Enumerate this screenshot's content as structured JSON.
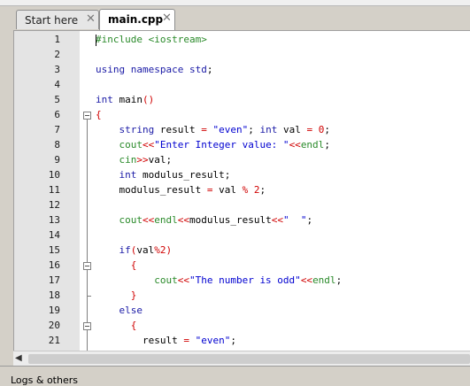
{
  "tabs": [
    {
      "label": "Start here",
      "close": "✕",
      "active": false
    },
    {
      "label": "main.cpp",
      "close": "✕",
      "active": true
    }
  ],
  "line_numbers": [
    "1",
    "2",
    "3",
    "4",
    "5",
    "6",
    "7",
    "8",
    "9",
    "10",
    "11",
    "12",
    "13",
    "14",
    "15",
    "16",
    "17",
    "18",
    "19",
    "20",
    "21"
  ],
  "code_lines": [
    [
      {
        "t": "#include <iostream>",
        "c": "pp"
      }
    ],
    [],
    [
      {
        "t": "using namespace ",
        "c": "kw"
      },
      {
        "t": "std",
        "c": "kw"
      },
      {
        "t": ";",
        "c": "plain"
      }
    ],
    [],
    [
      {
        "t": "int ",
        "c": "kw"
      },
      {
        "t": "main",
        "c": "plain"
      },
      {
        "t": "()",
        "c": "op"
      }
    ],
    [
      {
        "t": "{",
        "c": "op"
      }
    ],
    [
      {
        "t": "    string ",
        "c": "kw"
      },
      {
        "t": "result ",
        "c": "plain"
      },
      {
        "t": "= ",
        "c": "op"
      },
      {
        "t": "\"even\"",
        "c": "str"
      },
      {
        "t": "; ",
        "c": "plain"
      },
      {
        "t": "int ",
        "c": "kw"
      },
      {
        "t": "val ",
        "c": "plain"
      },
      {
        "t": "= ",
        "c": "op"
      },
      {
        "t": "0",
        "c": "num"
      },
      {
        "t": ";",
        "c": "plain"
      }
    ],
    [
      {
        "t": "    cout",
        "c": "io"
      },
      {
        "t": "<<",
        "c": "op"
      },
      {
        "t": "\"Enter Integer value: \"",
        "c": "str"
      },
      {
        "t": "<<",
        "c": "op"
      },
      {
        "t": "endl",
        "c": "io"
      },
      {
        "t": ";",
        "c": "plain"
      }
    ],
    [
      {
        "t": "    cin",
        "c": "io"
      },
      {
        "t": ">>",
        "c": "op"
      },
      {
        "t": "val",
        "c": "plain"
      },
      {
        "t": ";",
        "c": "plain"
      }
    ],
    [
      {
        "t": "    int ",
        "c": "kw"
      },
      {
        "t": "modulus_result",
        "c": "plain"
      },
      {
        "t": ";",
        "c": "plain"
      }
    ],
    [
      {
        "t": "    modulus_result ",
        "c": "plain"
      },
      {
        "t": "= ",
        "c": "op"
      },
      {
        "t": "val ",
        "c": "plain"
      },
      {
        "t": "% ",
        "c": "op"
      },
      {
        "t": "2",
        "c": "num"
      },
      {
        "t": ";",
        "c": "plain"
      }
    ],
    [],
    [
      {
        "t": "    cout",
        "c": "io"
      },
      {
        "t": "<<",
        "c": "op"
      },
      {
        "t": "endl",
        "c": "io"
      },
      {
        "t": "<<",
        "c": "op"
      },
      {
        "t": "modulus_result",
        "c": "plain"
      },
      {
        "t": "<<",
        "c": "op"
      },
      {
        "t": "\"  \"",
        "c": "str"
      },
      {
        "t": ";",
        "c": "plain"
      }
    ],
    [],
    [
      {
        "t": "    if",
        "c": "kw"
      },
      {
        "t": "(",
        "c": "op"
      },
      {
        "t": "val",
        "c": "plain"
      },
      {
        "t": "%",
        "c": "op"
      },
      {
        "t": "2",
        "c": "num"
      },
      {
        "t": ")",
        "c": "op"
      }
    ],
    [
      {
        "t": "      {",
        "c": "op"
      }
    ],
    [
      {
        "t": "          cout",
        "c": "io"
      },
      {
        "t": "<<",
        "c": "op"
      },
      {
        "t": "\"The number is odd\"",
        "c": "str"
      },
      {
        "t": "<<",
        "c": "op"
      },
      {
        "t": "endl",
        "c": "io"
      },
      {
        "t": ";",
        "c": "plain"
      }
    ],
    [
      {
        "t": "      }",
        "c": "op"
      }
    ],
    [
      {
        "t": "    else",
        "c": "kw"
      }
    ],
    [
      {
        "t": "      {",
        "c": "op"
      }
    ],
    [
      {
        "t": "        result ",
        "c": "plain"
      },
      {
        "t": "= ",
        "c": "op"
      },
      {
        "t": "\"even\"",
        "c": "str"
      },
      {
        "t": ";",
        "c": "plain"
      }
    ]
  ],
  "bottom_panel": {
    "label": "Logs & others"
  },
  "colors": {
    "keyword": "#1a1aa6",
    "string": "#0000d0",
    "operator": "#d00000",
    "preprocessor": "#2a8a2a",
    "number": "#d00000"
  }
}
